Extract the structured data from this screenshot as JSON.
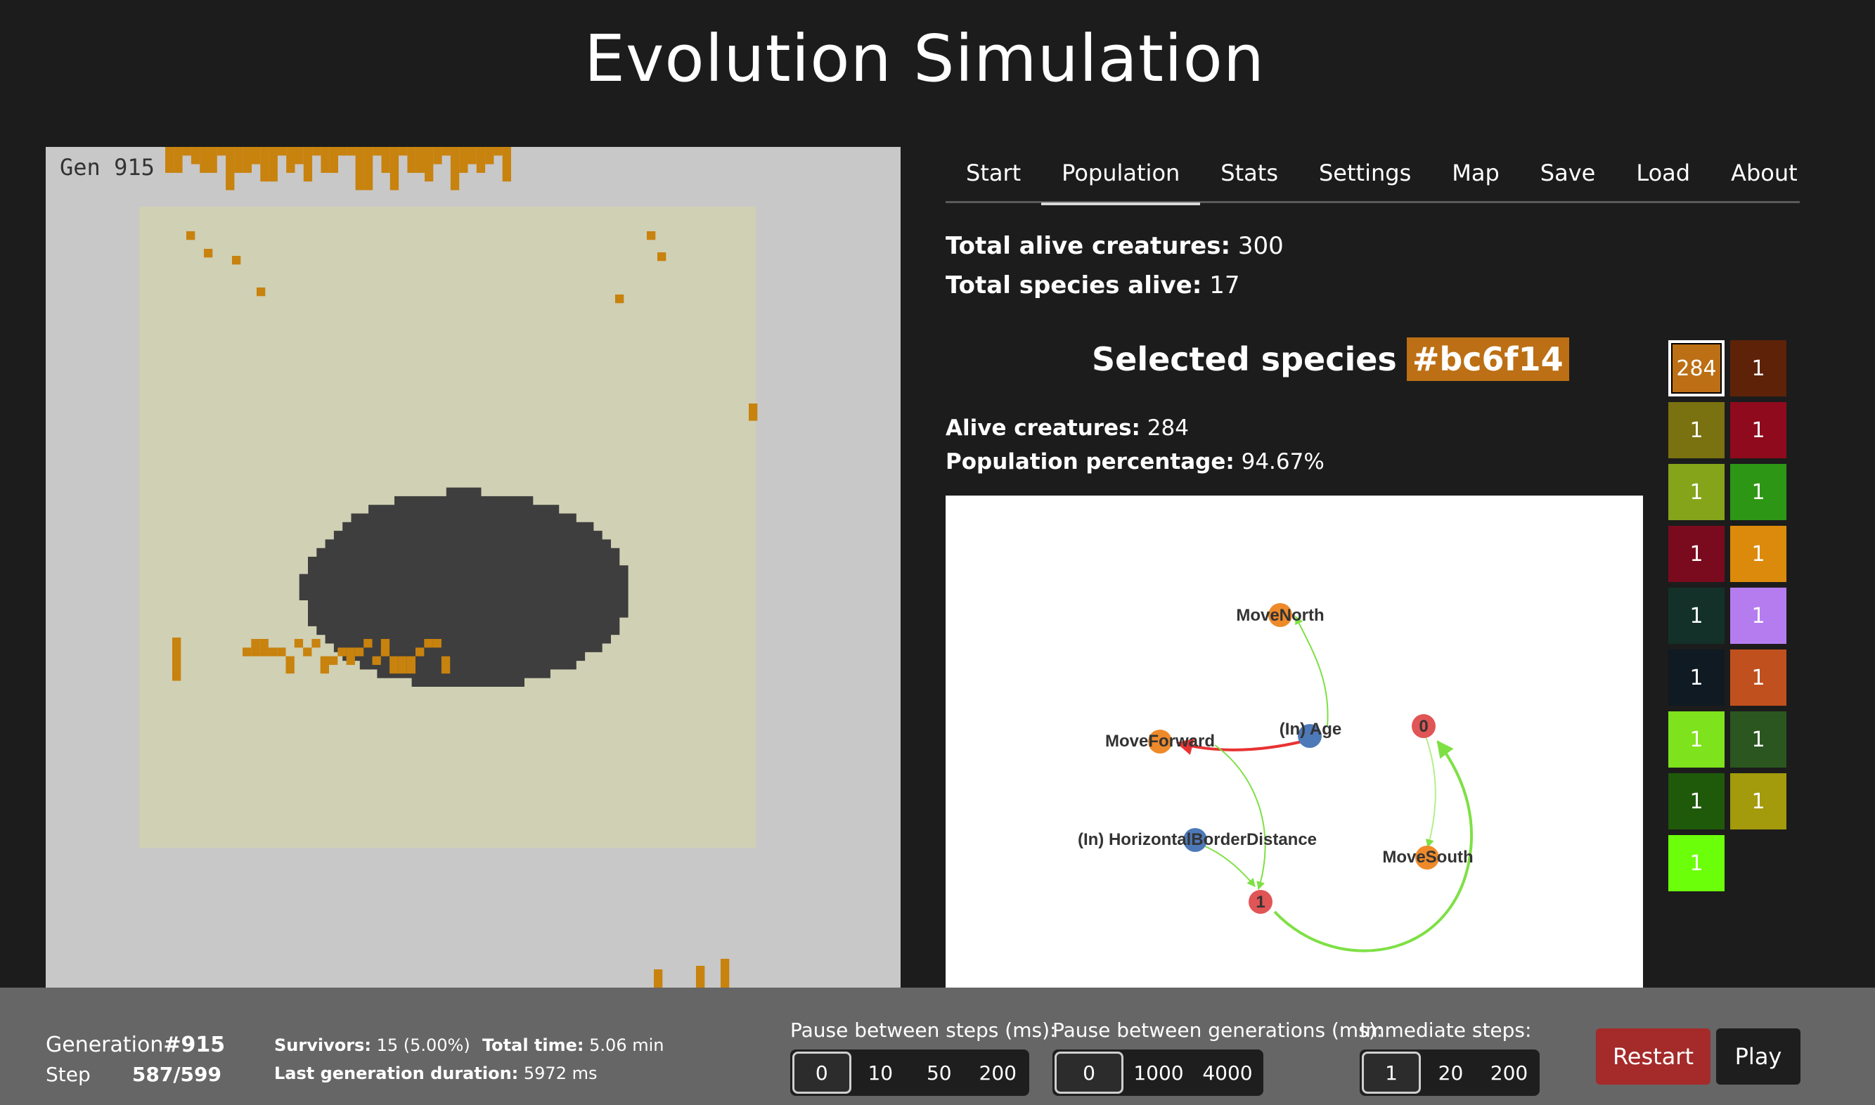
{
  "app": {
    "title": "Evolution Simulation"
  },
  "world": {
    "generation_label": "Gen 915"
  },
  "tabs": [
    {
      "label": "Start"
    },
    {
      "label": "Population"
    },
    {
      "label": "Stats"
    },
    {
      "label": "Settings"
    },
    {
      "label": "Map"
    },
    {
      "label": "Save"
    },
    {
      "label": "Load"
    },
    {
      "label": "About"
    }
  ],
  "active_tab": "Population",
  "population": {
    "total_alive_label": "Total alive creatures:",
    "total_alive_value": "300",
    "species_alive_label": "Total species alive:",
    "species_alive_value": "17",
    "selected_species_label": "Selected species",
    "selected_species_id": "#bc6f14",
    "alive_creatures_label": "Alive creatures:",
    "alive_creatures_value": "284",
    "population_pct_label": "Population percentage:",
    "population_pct_value": "94.67%"
  },
  "brain_graph": {
    "nodes": [
      {
        "id": "move-north",
        "label": "MoveNorth",
        "kind": "output",
        "color": "#ee8a2a"
      },
      {
        "id": "in-age",
        "label": "(In) Age",
        "kind": "input",
        "color": "#4e79b8"
      },
      {
        "id": "move-forward",
        "label": "MoveForward",
        "kind": "output",
        "color": "#ee8a2a"
      },
      {
        "id": "hidden-0",
        "label": "0",
        "kind": "hidden",
        "color": "#e05555"
      },
      {
        "id": "in-hbd",
        "label": "(In) HorizontalBorderDistance",
        "kind": "input",
        "color": "#4e79b8"
      },
      {
        "id": "move-south",
        "label": "MoveSouth",
        "kind": "output",
        "color": "#ee8a2a"
      },
      {
        "id": "hidden-1",
        "label": "1",
        "kind": "hidden",
        "color": "#e05555"
      }
    ],
    "edge_colors": {
      "positive": "#7ee045",
      "negative": "#e83232"
    }
  },
  "species": [
    {
      "count": "284",
      "color": "#bc6f14",
      "selected": true
    },
    {
      "count": "1",
      "color": "#5e2208"
    },
    {
      "count": "1",
      "color": "#7a7110"
    },
    {
      "count": "1",
      "color": "#8e0a1c"
    },
    {
      "count": "1",
      "color": "#86a41a"
    },
    {
      "count": "1",
      "color": "#2d9614"
    },
    {
      "count": "1",
      "color": "#7a0a1e"
    },
    {
      "count": "1",
      "color": "#dc8a0c"
    },
    {
      "count": "1",
      "color": "#133128"
    },
    {
      "count": "1",
      "color": "#b57cf0"
    },
    {
      "count": "1",
      "color": "#0f1a22"
    },
    {
      "count": "1",
      "color": "#c0501e"
    },
    {
      "count": "1",
      "color": "#7ee21c"
    },
    {
      "count": "1",
      "color": "#2b5620"
    },
    {
      "count": "1",
      "color": "#1f5a0a"
    },
    {
      "count": "1",
      "color": "#a39a0c"
    },
    {
      "count": "1",
      "color": "#6cff0a"
    }
  ],
  "footer": {
    "generation_label": "Generation",
    "generation_value": "#915",
    "step_label": "Step",
    "step_value": "587/599",
    "survivors_label": "Survivors:",
    "survivors_value": "15 (5.00%)",
    "total_time_label": "Total time:",
    "total_time_value": "5.06 min",
    "last_gen_label": "Last generation duration:",
    "last_gen_value": "5972 ms",
    "pause_steps_label": "Pause between steps (ms):",
    "pause_steps_options": [
      "0",
      "10",
      "50",
      "200"
    ],
    "pause_steps_selected": "0",
    "pause_gens_label": "Pause between generations (ms):",
    "pause_gens_options": [
      "0",
      "1000",
      "4000"
    ],
    "pause_gens_selected": "0",
    "immediate_label": "Immediate steps:",
    "immediate_options": [
      "1",
      "20",
      "200"
    ],
    "immediate_selected": "1",
    "restart_label": "Restart",
    "play_label": "Play"
  },
  "colors": {
    "background": "#1c1c1c",
    "footer": "#666666",
    "world_border": "#c8c8c8",
    "world_inner": "#d0d0b4",
    "obstacle": "#3e3e3e",
    "restart": "#a52a2a",
    "play": "#1e1e1e"
  }
}
